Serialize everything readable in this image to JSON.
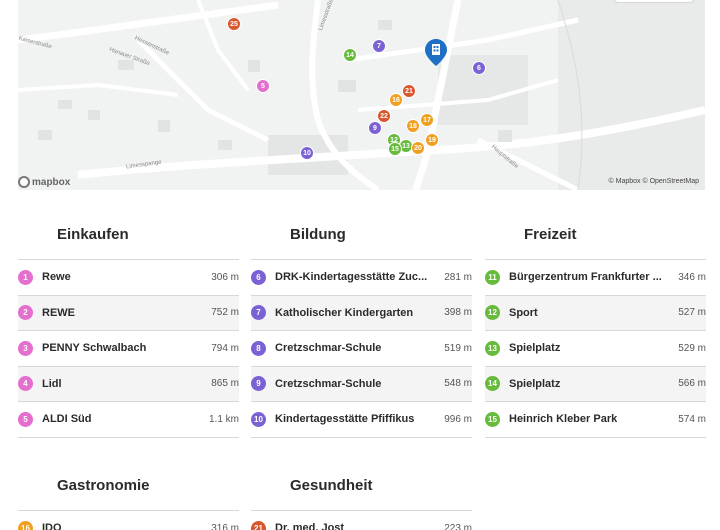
{
  "map": {
    "logo_text": "mapbox",
    "attribution": "© Mapbox © OpenStreetMap",
    "streets": [
      "Limesstraße",
      "Limesspange",
      "Hessenstraße",
      "Hanauer Straße",
      "Kaiserstraße",
      "Hauptstraße"
    ],
    "pins": [
      {
        "n": "25",
        "color": "#d9572e"
      },
      {
        "n": "14",
        "color": "#67bb3c"
      },
      {
        "n": "7",
        "color": "#7b62d4"
      },
      {
        "n": "6",
        "color": "#7b62d4"
      },
      {
        "n": "5",
        "color": "#e56fcf"
      },
      {
        "n": "21",
        "color": "#d9572e"
      },
      {
        "n": "16",
        "color": "#f0a020"
      },
      {
        "n": "22",
        "color": "#d9572e"
      },
      {
        "n": "17",
        "color": "#f0a020"
      },
      {
        "n": "9",
        "color": "#7b62d4"
      },
      {
        "n": "18",
        "color": "#f0a020"
      },
      {
        "n": "12",
        "color": "#67bb3c"
      },
      {
        "n": "13",
        "color": "#67bb3c"
      },
      {
        "n": "15",
        "color": "#67bb3c"
      },
      {
        "n": "20",
        "color": "#f0a020"
      },
      {
        "n": "19",
        "color": "#f0a020"
      },
      {
        "n": "10",
        "color": "#7b62d4"
      }
    ],
    "main_marker_icon": "building-icon",
    "main_marker_color": "#1f6fc4"
  },
  "sections": [
    {
      "title": "Einkaufen",
      "color": "#e56fcf",
      "items": [
        {
          "n": "1",
          "name": "Rewe",
          "dist": "306 m"
        },
        {
          "n": "2",
          "name": "REWE",
          "dist": "752 m"
        },
        {
          "n": "3",
          "name": "PENNY Schwalbach",
          "dist": "794 m"
        },
        {
          "n": "4",
          "name": "Lidl",
          "dist": "865 m"
        },
        {
          "n": "5",
          "name": "ALDI Süd",
          "dist": "1.1 km"
        }
      ]
    },
    {
      "title": "Bildung",
      "color": "#7b62d4",
      "items": [
        {
          "n": "6",
          "name": "DRK-Kindertagesstätte Zuc...",
          "dist": "281 m"
        },
        {
          "n": "7",
          "name": "Katholischer Kindergarten",
          "dist": "398 m"
        },
        {
          "n": "8",
          "name": "Cretzschmar-Schule",
          "dist": "519 m"
        },
        {
          "n": "9",
          "name": "Cretzschmar-Schule",
          "dist": "548 m"
        },
        {
          "n": "10",
          "name": "Kindertagesstätte Pfiffikus",
          "dist": "996 m"
        }
      ]
    },
    {
      "title": "Freizeit",
      "color": "#67bb3c",
      "items": [
        {
          "n": "11",
          "name": "Bürgerzentrum Frankfurter ...",
          "dist": "346 m"
        },
        {
          "n": "12",
          "name": "Sport",
          "dist": "527 m"
        },
        {
          "n": "13",
          "name": "Spielplatz",
          "dist": "529 m"
        },
        {
          "n": "14",
          "name": "Spielplatz",
          "dist": "566 m"
        },
        {
          "n": "15",
          "name": "Heinrich Kleber Park",
          "dist": "574 m"
        }
      ]
    },
    {
      "title": "Gastronomie",
      "color": "#f0a020",
      "items": [
        {
          "n": "16",
          "name": "IDO",
          "dist": "316 m"
        }
      ]
    },
    {
      "title": "Gesundheit",
      "color": "#d9572e",
      "items": [
        {
          "n": "21",
          "name": "Dr. med. Jost",
          "dist": "223 m"
        }
      ]
    }
  ]
}
